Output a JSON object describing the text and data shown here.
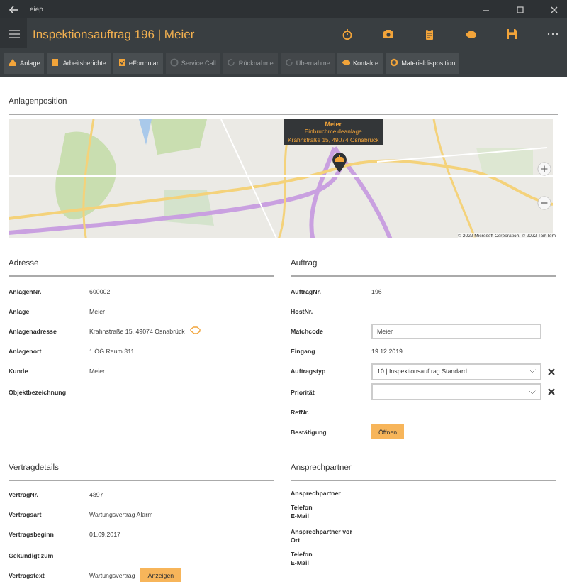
{
  "window": {
    "app_name": "eiep",
    "title": "Inspektionsauftrag 196 | Meier"
  },
  "toolbar": [
    {
      "label": "Anlage",
      "disabled": false
    },
    {
      "label": "Arbeitsberichte",
      "disabled": false
    },
    {
      "label": "eFormular",
      "disabled": false
    },
    {
      "label": "Service Call",
      "disabled": true
    },
    {
      "label": "Rücknahme",
      "disabled": true
    },
    {
      "label": "Übernahme",
      "disabled": true
    },
    {
      "label": "Kontakte",
      "disabled": false
    },
    {
      "label": "Materialdisposition",
      "disabled": false
    }
  ],
  "map": {
    "title": "Anlagenposition",
    "popup": {
      "name": "Meier",
      "type": "Einbruchmeldeanlage",
      "address": "Krahnstraße 15, 49074 Osnabrück"
    },
    "copyright": "© 2022 Microsoft Corporation, © 2022 TomTom"
  },
  "address": {
    "title": "Adresse",
    "rows": [
      {
        "kind": "text",
        "label": "AnlagenNr.",
        "value": "600002"
      },
      {
        "kind": "text",
        "label": "Anlage",
        "value": "Meier"
      },
      {
        "kind": "text_icon",
        "label": "Anlagenadresse",
        "value": "Krahnstraße 15, 49074 Osnabrück"
      },
      {
        "kind": "text",
        "label": "Anlagenort",
        "value": "1 OG Raum 311"
      },
      {
        "kind": "text",
        "label": "Kunde",
        "value": "Meier"
      },
      {
        "kind": "text",
        "label": "Objektbezeichnung"
      }
    ]
  },
  "order": {
    "title": "Auftrag",
    "rows": [
      {
        "kind": "text",
        "label": "AuftragNr.",
        "value": "196"
      },
      {
        "kind": "text",
        "label": "HostNr."
      },
      {
        "kind": "field",
        "label": "Matchcode",
        "value": "Meier"
      },
      {
        "kind": "text",
        "label": "Eingang",
        "value": "19.12.2019"
      },
      {
        "kind": "dropdown",
        "label": "Auftragstyp",
        "value": "10  |  Inspektionsauftrag Standard"
      },
      {
        "kind": "dropdown",
        "label": "Priorität"
      },
      {
        "kind": "text",
        "label": "RefNr."
      },
      {
        "kind": "button",
        "label": "Bestätigung",
        "button": "Öffnen"
      }
    ]
  },
  "contract": {
    "title": "Vertragdetails",
    "rows": [
      {
        "kind": "text",
        "label": "VertragNr.",
        "value": "4897"
      },
      {
        "kind": "text",
        "label": "Vertragsart",
        "value": "Wartungsvertrag Alarm"
      },
      {
        "kind": "text",
        "label": "Vertragsbeginn",
        "value": "01.09.2017"
      },
      {
        "kind": "text",
        "label": "Gekündigt zum"
      },
      {
        "kind": "text_button",
        "label": "Vertragstext",
        "value": "Wartungsvertrag",
        "button": "Anzeigen"
      }
    ]
  },
  "contacts": {
    "title": "Ansprechpartner",
    "groups": [
      {
        "labels": [
          "Ansprechpartner"
        ]
      },
      {
        "labels": [
          "Telefon",
          "E-Mail"
        ]
      },
      {
        "labels": [
          "Ansprechpartner vor Ort"
        ]
      },
      {
        "labels": [
          "Telefon",
          "E-Mail"
        ]
      }
    ]
  }
}
